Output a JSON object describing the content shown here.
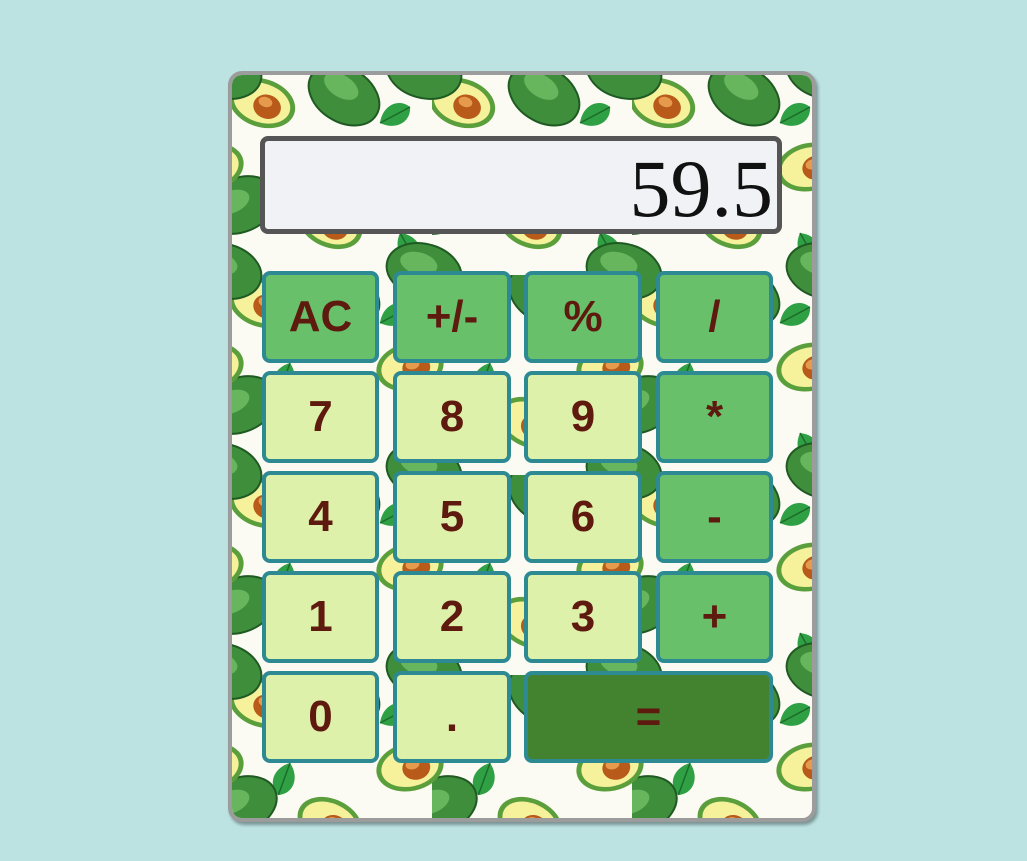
{
  "display": {
    "value": "59.5"
  },
  "keys": {
    "row1": [
      "AC",
      "+/-",
      "%",
      "/"
    ],
    "row2": [
      "7",
      "8",
      "9",
      "*"
    ],
    "row3": [
      "4",
      "5",
      "6",
      "-"
    ],
    "row4": [
      "1",
      "2",
      "3",
      "+"
    ],
    "row5": [
      "0",
      ".",
      "="
    ]
  },
  "colors": {
    "page_background": "#bce3e2",
    "function_key": "#68c06a",
    "digit_key": "#def1aa",
    "equals_key": "#43832f",
    "key_border": "#2e8a92",
    "key_text": "#5e1a0e",
    "display_background": "#f1f2f6",
    "display_border": "#555555"
  },
  "background_pattern": "avocado-pattern"
}
